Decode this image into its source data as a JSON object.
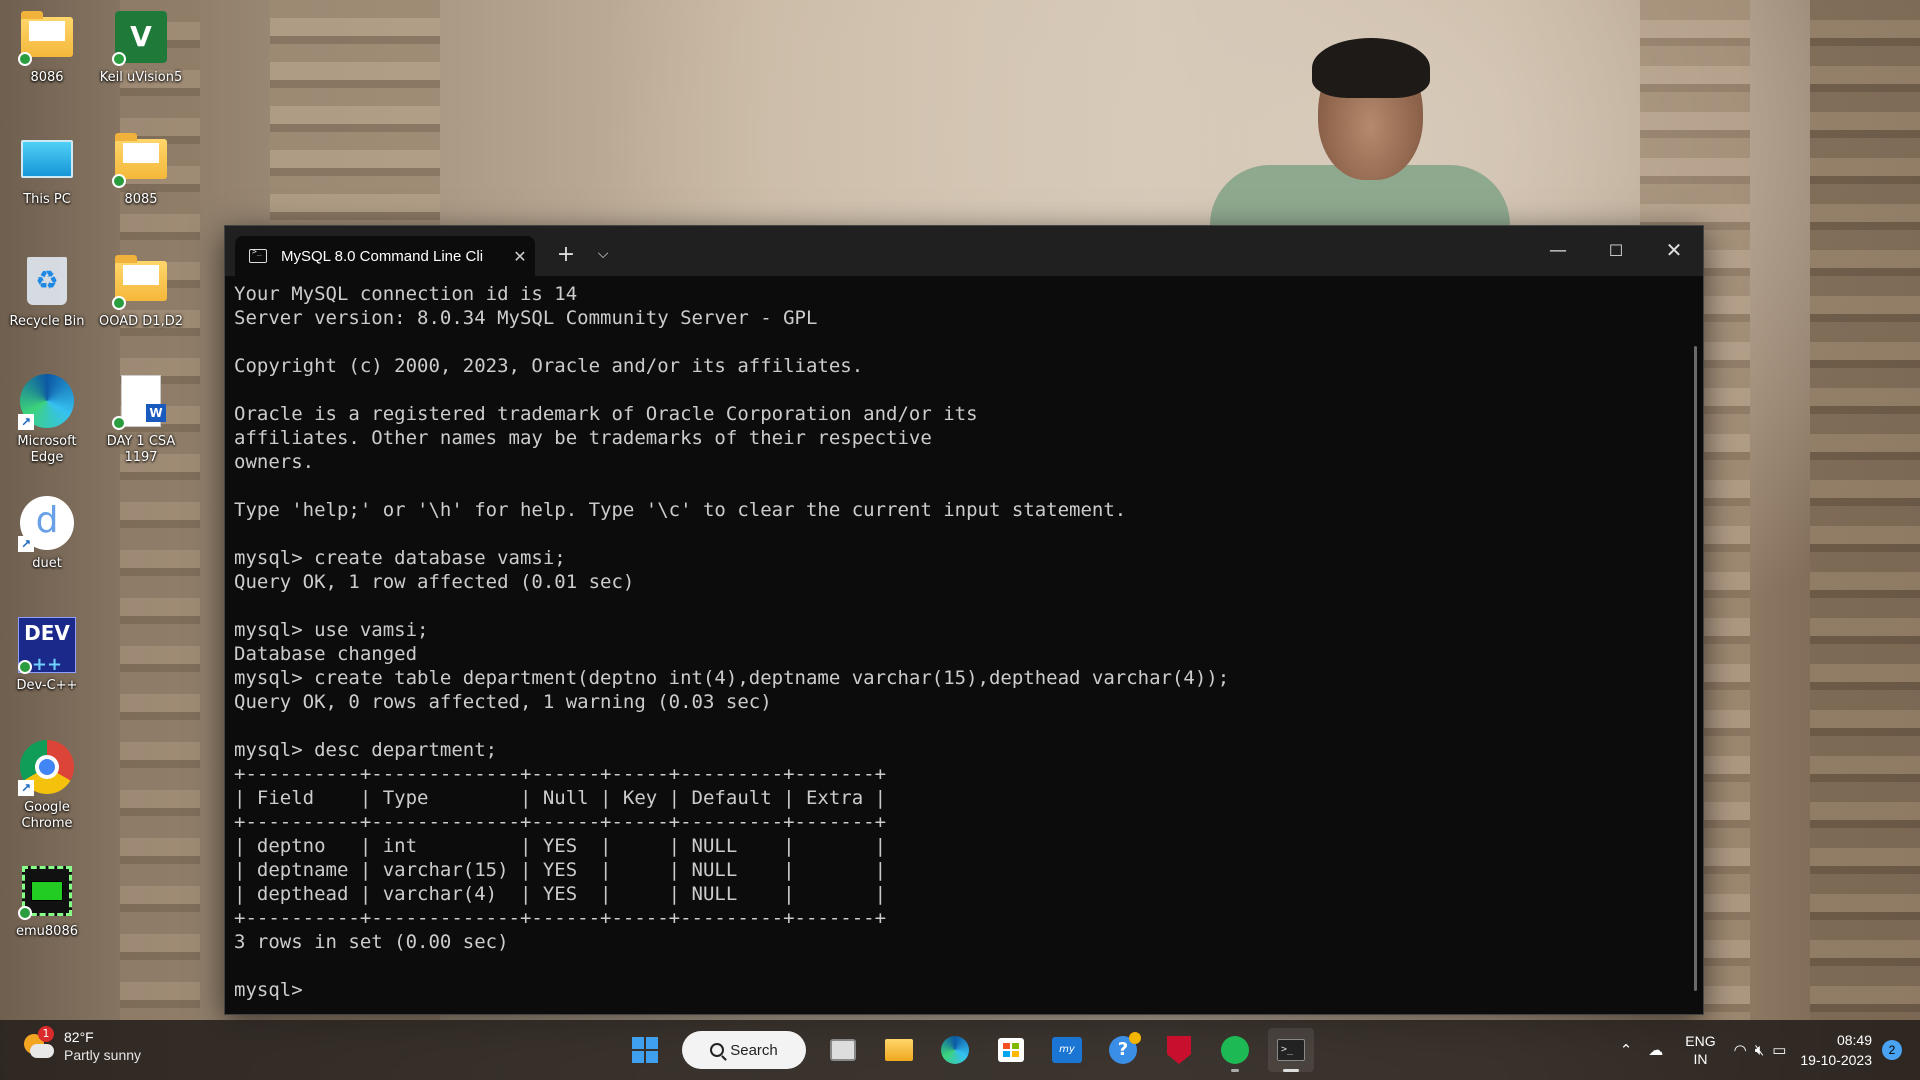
{
  "desktop": {
    "icons": [
      {
        "label": "8086"
      },
      {
        "label": "Keil uVision5"
      },
      {
        "label": "This PC"
      },
      {
        "label": "8085"
      },
      {
        "label": "Recycle Bin"
      },
      {
        "label": "OOAD D1,D2"
      },
      {
        "label": "Microsoft Edge"
      },
      {
        "label": "DAY 1 CSA 1197"
      },
      {
        "label": "duet"
      },
      {
        "label": "Dev-C++"
      },
      {
        "label": "Google Chrome"
      },
      {
        "label": "emu8086"
      }
    ]
  },
  "terminal": {
    "tab_title": "MySQL 8.0 Command Line Cli",
    "new_tab_symbol": "+",
    "dropdown_symbol": "⌵",
    "lines": [
      "Your MySQL connection id is 14",
      "Server version: 8.0.34 MySQL Community Server - GPL",
      "",
      "Copyright (c) 2000, 2023, Oracle and/or its affiliates.",
      "",
      "Oracle is a registered trademark of Oracle Corporation and/or its",
      "affiliates. Other names may be trademarks of their respective",
      "owners.",
      "",
      "Type 'help;' or '\\h' for help. Type '\\c' to clear the current input statement.",
      "",
      "mysql> create database vamsi;",
      "Query OK, 1 row affected (0.01 sec)",
      "",
      "mysql> use vamsi;",
      "Database changed",
      "mysql> create table department(deptno int(4),deptname varchar(15),depthead varchar(4));",
      "Query OK, 0 rows affected, 1 warning (0.03 sec)",
      "",
      "mysql> desc department;",
      "+----------+-------------+------+-----+---------+-------+",
      "| Field    | Type        | Null | Key | Default | Extra |",
      "+----------+-------------+------+-----+---------+-------+",
      "| deptno   | int         | YES  |     | NULL    |       |",
      "| deptname | varchar(15) | YES  |     | NULL    |       |",
      "| depthead | varchar(4)  | YES  |     | NULL    |       |",
      "+----------+-------------+------+-----+---------+-------+",
      "3 rows in set (0.00 sec)",
      "",
      "mysql>"
    ]
  },
  "taskbar": {
    "weather_badge": "1",
    "weather_temp": "82°F",
    "weather_desc": "Partly sunny",
    "search_label": "Search",
    "lang_top": "ENG",
    "lang_bottom": "IN",
    "time": "08:49",
    "date": "19-10-2023",
    "notification_count": "2"
  },
  "colors": {
    "terminal_bg": "#0c0c0c",
    "terminal_fg": "#cccccc",
    "titlebar_bg": "#202020",
    "accent": "#3fa0f0"
  }
}
